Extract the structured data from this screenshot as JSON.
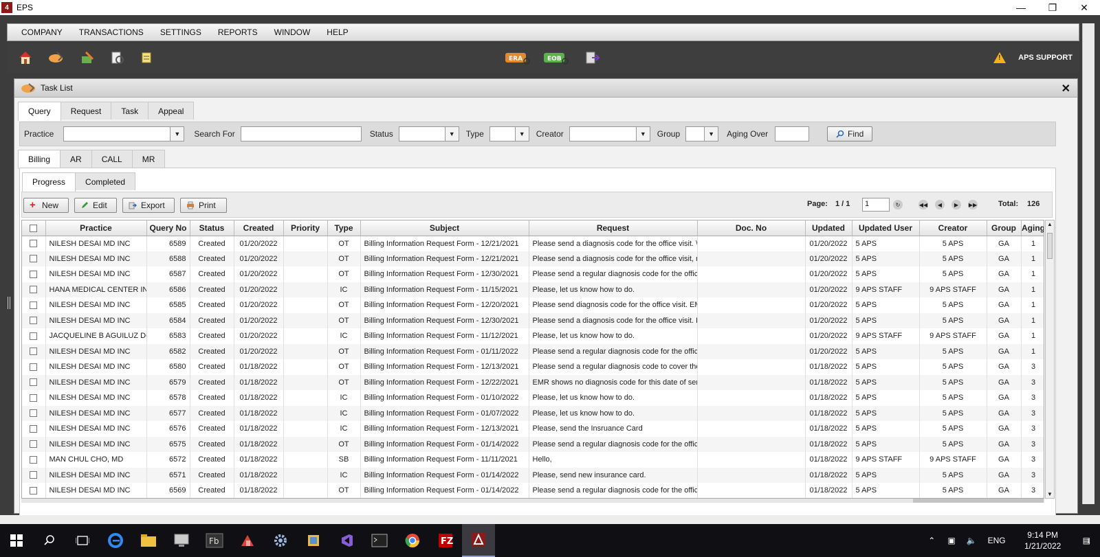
{
  "os": {
    "title": "EPS",
    "app_letter": "4"
  },
  "menu": [
    "COMPANY",
    "TRANSACTIONS",
    "SETTINGS",
    "REPORTS",
    "WINDOW",
    "HELP"
  ],
  "toolbar": {
    "era_label": "ERA",
    "eob_label": "EOB",
    "support_label": "APS SUPPORT"
  },
  "window": {
    "title": "Task List",
    "close": "✕",
    "main_tabs": [
      "Query",
      "Request",
      "Task",
      "Appeal"
    ],
    "filters": {
      "practice": "Practice",
      "search_for": "Search For",
      "status": "Status",
      "type": "Type",
      "creator": "Creator",
      "group": "Group",
      "aging_over": "Aging Over",
      "find": "Find"
    },
    "sub_tabs": [
      "Billing",
      "AR",
      "CALL",
      "MR"
    ],
    "progress_tabs": [
      "Progress",
      "Completed"
    ],
    "actions": {
      "new": "New",
      "edit": "Edit",
      "export": "Export",
      "print": "Print"
    },
    "pager": {
      "page_label": "Page:",
      "page_value": "1 / 1",
      "page_input": "1",
      "total_label": "Total:",
      "total_value": "126"
    }
  },
  "table": {
    "columns": [
      "Practice",
      "Query No",
      "Status",
      "Created",
      "Priority",
      "Type",
      "Subject",
      "Request",
      "Doc. No",
      "Updated",
      "Updated User",
      "Creator",
      "Group",
      "Aging"
    ],
    "rows": [
      [
        "NILESH DESAI MD INC",
        "6589",
        "Created",
        "01/20/2022",
        "",
        "OT",
        "Billing Information Request Form - 12/21/2021",
        "Please send a diagnosis code for the office visit. \\",
        "",
        "01/20/2022",
        "5 APS",
        "5 APS",
        "GA",
        "1"
      ],
      [
        "NILESH DESAI MD INC",
        "6588",
        "Created",
        "01/20/2022",
        "",
        "OT",
        "Billing Information Request Form - 12/21/2021",
        "Please send a diagnosis code for the office visit, r",
        "",
        "01/20/2022",
        "5 APS",
        "5 APS",
        "GA",
        "1"
      ],
      [
        "NILESH DESAI MD INC",
        "6587",
        "Created",
        "01/20/2022",
        "",
        "OT",
        "Billing Information Request Form - 12/30/2021",
        "Please send a regular diagnosis code for the offic",
        "",
        "01/20/2022",
        "5 APS",
        "5 APS",
        "GA",
        "1"
      ],
      [
        "HANA MEDICAL CENTER INC",
        "6586",
        "Created",
        "01/20/2022",
        "",
        "IC",
        "Billing Information Request Form - 11/15/2021",
        "Please, let us know how to do.",
        "",
        "01/20/2022",
        "9 APS STAFF",
        "9 APS STAFF",
        "GA",
        "1"
      ],
      [
        "NILESH DESAI MD INC",
        "6585",
        "Created",
        "01/20/2022",
        "",
        "OT",
        "Billing Information Request Form - 12/20/2021",
        "Please send diagnosis code for the office visit. EM",
        "",
        "01/20/2022",
        "5 APS",
        "5 APS",
        "GA",
        "1"
      ],
      [
        "NILESH DESAI MD INC",
        "6584",
        "Created",
        "01/20/2022",
        "",
        "OT",
        "Billing Information Request Form - 12/30/2021",
        "Please send a diagnosis code for the office visit. F",
        "",
        "01/20/2022",
        "5 APS",
        "5 APS",
        "GA",
        "1"
      ],
      [
        "JACQUELINE B AGUILUZ DO",
        "6583",
        "Created",
        "01/20/2022",
        "",
        "IC",
        "Billing Information Request Form - 11/12/2021",
        "Please, let us know how to do.",
        "",
        "01/20/2022",
        "9 APS STAFF",
        "9 APS STAFF",
        "GA",
        "1"
      ],
      [
        "NILESH DESAI MD INC",
        "6582",
        "Created",
        "01/20/2022",
        "",
        "OT",
        "Billing Information Request Form - 01/11/2022",
        "Please send a regular diagnosis code for the offic",
        "",
        "01/20/2022",
        "5 APS",
        "5 APS",
        "GA",
        "1"
      ],
      [
        "NILESH DESAI MD INC",
        "6580",
        "Created",
        "01/18/2022",
        "",
        "OT",
        "Billing Information Request Form - 12/13/2021",
        "Please send a regular diagnosis code to cover the",
        "",
        "01/18/2022",
        "5 APS",
        "5 APS",
        "GA",
        "3"
      ],
      [
        "NILESH DESAI MD INC",
        "6579",
        "Created",
        "01/18/2022",
        "",
        "OT",
        "Billing Information Request Form - 12/22/2021",
        "EMR shows no diagnosis code for this date of ser",
        "",
        "01/18/2022",
        "5 APS",
        "5 APS",
        "GA",
        "3"
      ],
      [
        "NILESH DESAI MD INC",
        "6578",
        "Created",
        "01/18/2022",
        "",
        "IC",
        "Billing Information Request Form - 01/10/2022",
        "Please, let us know how to do.",
        "",
        "01/18/2022",
        "5 APS",
        "5 APS",
        "GA",
        "3"
      ],
      [
        "NILESH DESAI MD INC",
        "6577",
        "Created",
        "01/18/2022",
        "",
        "IC",
        "Billing Information Request Form - 01/07/2022",
        "Please, let us know how to do.",
        "",
        "01/18/2022",
        "5 APS",
        "5 APS",
        "GA",
        "3"
      ],
      [
        "NILESH DESAI MD INC",
        "6576",
        "Created",
        "01/18/2022",
        "",
        "IC",
        "Billing Information Request Form - 12/13/2021",
        "Please, send the Insruance Card",
        "",
        "01/18/2022",
        "5 APS",
        "5 APS",
        "GA",
        "3"
      ],
      [
        "NILESH DESAI MD INC",
        "6575",
        "Created",
        "01/18/2022",
        "",
        "OT",
        "Billing Information Request Form - 01/14/2022",
        "Please send a regular diagnosis code for the offic",
        "",
        "01/18/2022",
        "5 APS",
        "5 APS",
        "GA",
        "3"
      ],
      [
        "MAN CHUL CHO, MD",
        "6572",
        "Created",
        "01/18/2022",
        "",
        "SB",
        "Billing Information Request Form - 11/11/2021",
        "Hello,",
        "",
        "01/18/2022",
        "9 APS STAFF",
        "9 APS STAFF",
        "GA",
        "3"
      ],
      [
        "NILESH DESAI MD INC",
        "6571",
        "Created",
        "01/18/2022",
        "",
        "IC",
        "Billing Information Request Form - 01/14/2022",
        "Please, send new insurance card.",
        "",
        "01/18/2022",
        "5 APS",
        "5 APS",
        "GA",
        "3"
      ],
      [
        "NILESH DESAI MD INC",
        "6569",
        "Created",
        "01/18/2022",
        "",
        "OT",
        "Billing Information Request Form - 01/14/2022",
        "Please send a regular diagnosis code for the offic",
        "",
        "01/18/2022",
        "5 APS",
        "5 APS",
        "GA",
        "3"
      ]
    ]
  },
  "taskbar": {
    "lang": "ENG",
    "time": "9:14 PM",
    "date": "1/21/2022",
    "notif_count": "1"
  }
}
